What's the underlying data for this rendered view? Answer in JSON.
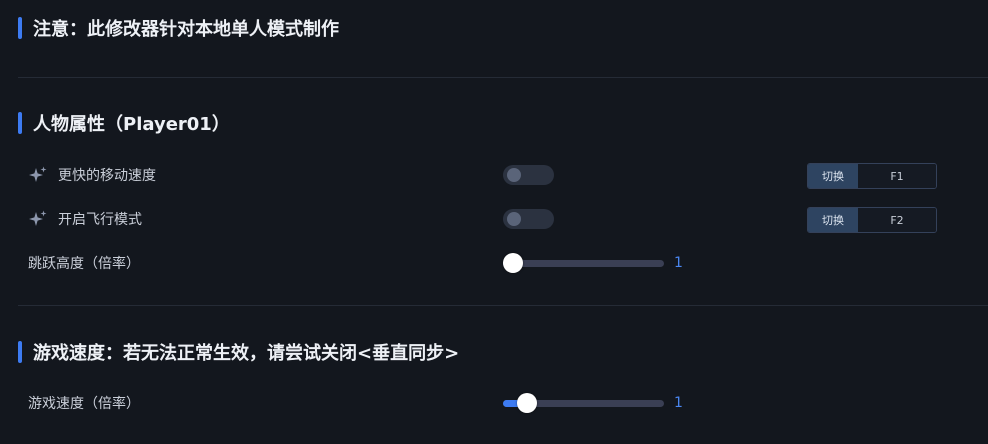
{
  "colors": {
    "background": "#13171e",
    "accent": "#3d7bf2",
    "toggle_off": "#2b3240",
    "hotkey_switch_bg": "#2e4461"
  },
  "notice": {
    "title": "注意：此修改器针对本地单人模式制作"
  },
  "player_section": {
    "title": "人物属性（Player01）",
    "rows": [
      {
        "icon": "sparkle-icon",
        "label": "更快的移动速度",
        "enabled": false,
        "switch_label": "切换",
        "hotkey": "F1"
      },
      {
        "icon": "sparkle-icon",
        "label": "开启飞行模式",
        "enabled": false,
        "switch_label": "切换",
        "hotkey": "F2"
      }
    ],
    "jump": {
      "label": "跳跃高度（倍率）",
      "value": "1",
      "fraction": 0.0
    }
  },
  "speed_section": {
    "title": "游戏速度：若无法正常生效，请尝试关闭<垂直同步>",
    "game_speed": {
      "label": "游戏速度（倍率）",
      "value": "1",
      "fraction": 0.1
    }
  }
}
